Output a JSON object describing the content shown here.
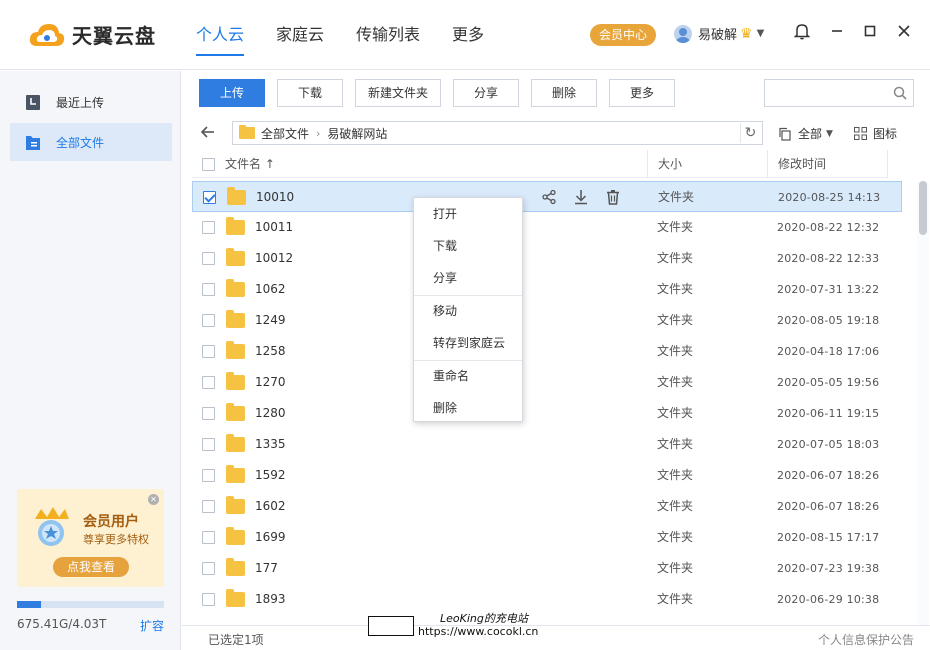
{
  "app": {
    "logo_text": "天翼云盘",
    "nav": [
      {
        "label": "个人云",
        "active": true
      },
      {
        "label": "家庭云",
        "active": false
      },
      {
        "label": "传输列表",
        "active": false
      },
      {
        "label": "更多",
        "active": false
      }
    ],
    "vip_label": "会员中心",
    "username": "易破解",
    "accent": "#1d7ae8"
  },
  "sidebar": {
    "items": [
      {
        "label": "最近上传",
        "icon": "recent-upload-icon"
      },
      {
        "label": "全部文件",
        "icon": "all-files-icon",
        "active": true
      }
    ],
    "promo": {
      "title": "会员用户",
      "subtitle": "尊享更多特权",
      "button": "点我查看"
    },
    "quota": {
      "text": "675.41G/4.03T",
      "used_fraction": 0.16,
      "expand": "扩容"
    }
  },
  "toolbar": {
    "buttons": [
      "上传",
      "下载",
      "新建文件夹",
      "分享",
      "删除",
      "更多"
    ],
    "search_placeholder": ""
  },
  "breadcrumb": {
    "items": [
      "全部文件",
      "易破解网站"
    ],
    "filter": "全部",
    "view": "图标"
  },
  "table": {
    "headers": {
      "name": "文件名 ↑",
      "size": "大小",
      "modified": "修改时间"
    },
    "rows": [
      {
        "name": "10010",
        "size": "文件夹",
        "modified": "2020-08-25  14:13",
        "selected": true
      },
      {
        "name": "10011",
        "size": "文件夹",
        "modified": "2020-08-22  12:32"
      },
      {
        "name": "10012",
        "size": "文件夹",
        "modified": "2020-08-22  12:33"
      },
      {
        "name": "1062",
        "size": "文件夹",
        "modified": "2020-07-31  13:22"
      },
      {
        "name": "1249",
        "size": "文件夹",
        "modified": "2020-08-05  19:18"
      },
      {
        "name": "1258",
        "size": "文件夹",
        "modified": "2020-04-18  17:06"
      },
      {
        "name": "1270",
        "size": "文件夹",
        "modified": "2020-05-05  19:56"
      },
      {
        "name": "1280",
        "size": "文件夹",
        "modified": "2020-06-11  19:15"
      },
      {
        "name": "1335",
        "size": "文件夹",
        "modified": "2020-07-05  18:03"
      },
      {
        "name": "1592",
        "size": "文件夹",
        "modified": "2020-06-07  18:26"
      },
      {
        "name": "1602",
        "size": "文件夹",
        "modified": "2020-06-07  18:26"
      },
      {
        "name": "1699",
        "size": "文件夹",
        "modified": "2020-08-15  17:17"
      },
      {
        "name": "177",
        "size": "文件夹",
        "modified": "2020-07-23  19:38"
      },
      {
        "name": "1893",
        "size": "文件夹",
        "modified": "2020-06-29  10:38"
      }
    ]
  },
  "context_menu": {
    "groups": [
      [
        "打开",
        "下载",
        "分享"
      ],
      [
        "移动",
        "转存到家庭云"
      ],
      [
        "重命名",
        "删除"
      ]
    ]
  },
  "status": {
    "selected": "已选定1项",
    "privacy": "个人信息保护公告"
  },
  "watermark": {
    "line1": "LeoKing的充电站",
    "line2": "https://www.cocokl.cn"
  }
}
